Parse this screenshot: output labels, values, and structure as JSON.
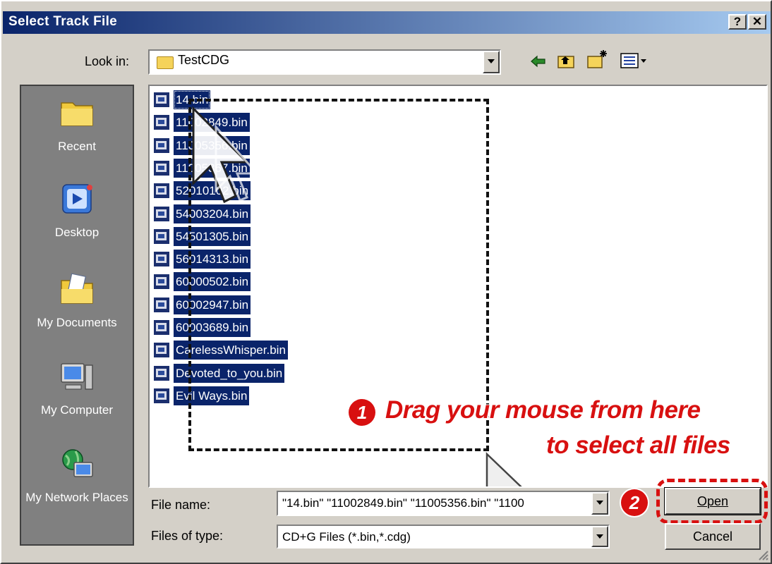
{
  "window": {
    "title": "Select Track File",
    "help_label": "?",
    "close_label": "✕"
  },
  "look_in": {
    "label": "Look in:",
    "value": "TestCDG"
  },
  "toolbar": {
    "back_icon": "back-arrow-icon",
    "up_icon": "up-folder-icon",
    "new_folder_icon": "new-folder-icon",
    "views_icon": "views-menu-icon"
  },
  "places": [
    {
      "label": "Recent",
      "icon": "recent-folder-icon"
    },
    {
      "label": "Desktop",
      "icon": "desktop-icon"
    },
    {
      "label": "My Documents",
      "icon": "my-documents-icon"
    },
    {
      "label": "My Computer",
      "icon": "my-computer-icon"
    },
    {
      "label": "My Network Places",
      "icon": "network-places-icon"
    }
  ],
  "files": [
    "14.bin",
    "11002849.bin",
    "11005356.bin",
    "11005367.bin",
    "52010102.bin",
    "54003204.bin",
    "54501305.bin",
    "56014313.bin",
    "60000502.bin",
    "60002947.bin",
    "60003689.bin",
    "CarelessWhisper.bin",
    "Devoted_to_you.bin",
    "Evil Ways.bin"
  ],
  "file_name": {
    "label": "File name:",
    "value": "\"14.bin\" \"11002849.bin\" \"11005356.bin\" \"1100"
  },
  "file_type": {
    "label": "Files of type:",
    "value": "CD+G Files (*.bin,*.cdg)"
  },
  "buttons": {
    "open": "Open",
    "cancel": "Cancel"
  },
  "annotations": {
    "step1_number": "1",
    "step1_line1": "Drag your mouse from here",
    "step1_line2": "to select all files",
    "step2_number": "2"
  },
  "colors": {
    "selection": "#0a246a",
    "annotation": "#d81010",
    "title_bar": "#0a246a"
  }
}
